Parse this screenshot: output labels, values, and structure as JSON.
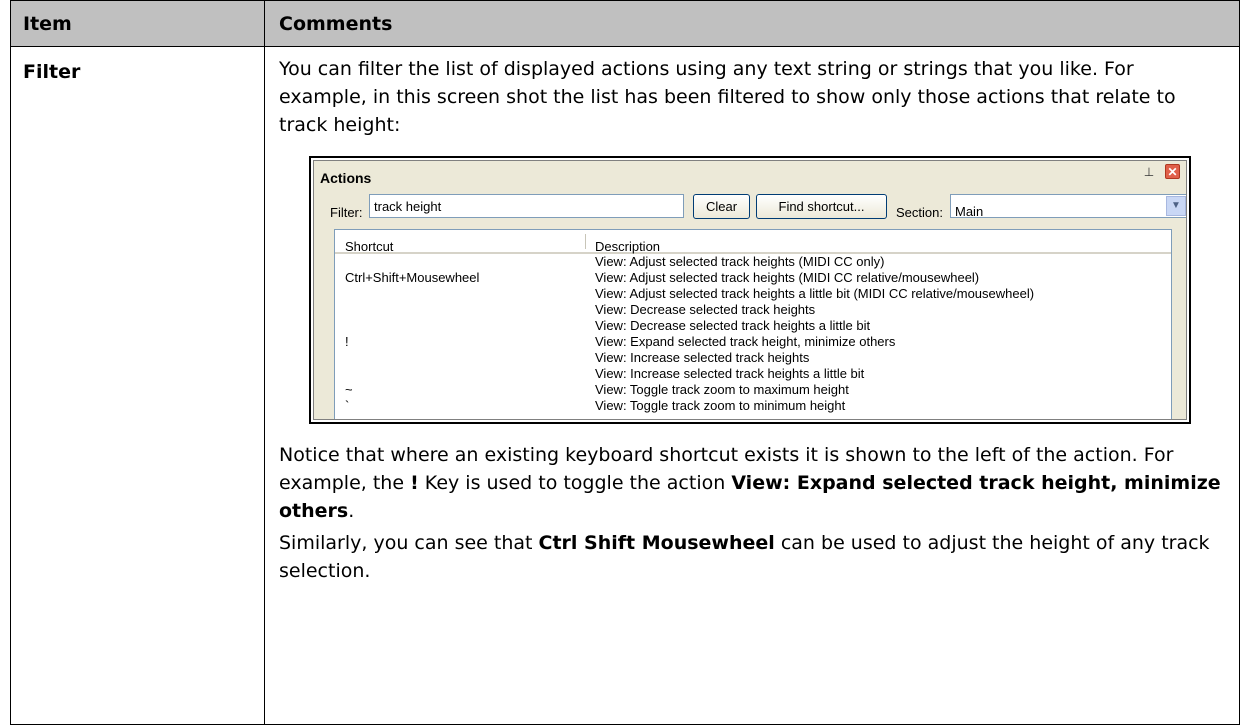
{
  "table": {
    "headers": {
      "item": "Item",
      "comments": "Comments"
    },
    "row": {
      "item": "Filter",
      "intro": "You can filter the list of displayed actions using any text string or strings that you like. For example, in this screen shot the list has been filtered to show only those actions that relate to track height:",
      "notice": {
        "part1": "Notice that where an existing keyboard shortcut exists it is shown to the left of the action. For example, the ",
        "key": "!",
        "part2": " Key is used to toggle the action ",
        "action": "View: Expand selected track height, minimize others",
        "part3": "."
      },
      "similarly": {
        "part1": "Similarly, you can see that ",
        "shortcut": "Ctrl Shift Mousewheel",
        "part2": " can be used to adjust the height of any track selection."
      }
    }
  },
  "actions_window": {
    "title": "Actions",
    "pin_icon": "pin-icon",
    "close_icon": "close-icon",
    "filter_label": "Filter:",
    "filter_value": "track height",
    "clear_label": "Clear",
    "find_shortcut_label": "Find shortcut...",
    "section_label": "Section:",
    "section_value": "Main",
    "columns": {
      "shortcut": "Shortcut",
      "description": "Description"
    },
    "rows": [
      {
        "shortcut": "",
        "description": "View: Adjust selected track heights (MIDI CC only)"
      },
      {
        "shortcut": "Ctrl+Shift+Mousewheel",
        "description": "View: Adjust selected track heights (MIDI CC relative/mousewheel)"
      },
      {
        "shortcut": "",
        "description": "View: Adjust selected track heights a little bit (MIDI CC relative/mousewheel)"
      },
      {
        "shortcut": "",
        "description": "View: Decrease selected track heights"
      },
      {
        "shortcut": "",
        "description": "View: Decrease selected track heights a little bit"
      },
      {
        "shortcut": "!",
        "description": "View: Expand selected track height, minimize others"
      },
      {
        "shortcut": "",
        "description": "View: Increase selected track heights"
      },
      {
        "shortcut": "",
        "description": "View: Increase selected track heights a little bit"
      },
      {
        "shortcut": "~",
        "description": "View: Toggle track zoom to maximum height"
      },
      {
        "shortcut": "`",
        "description": "View: Toggle track zoom to minimum height"
      }
    ]
  }
}
